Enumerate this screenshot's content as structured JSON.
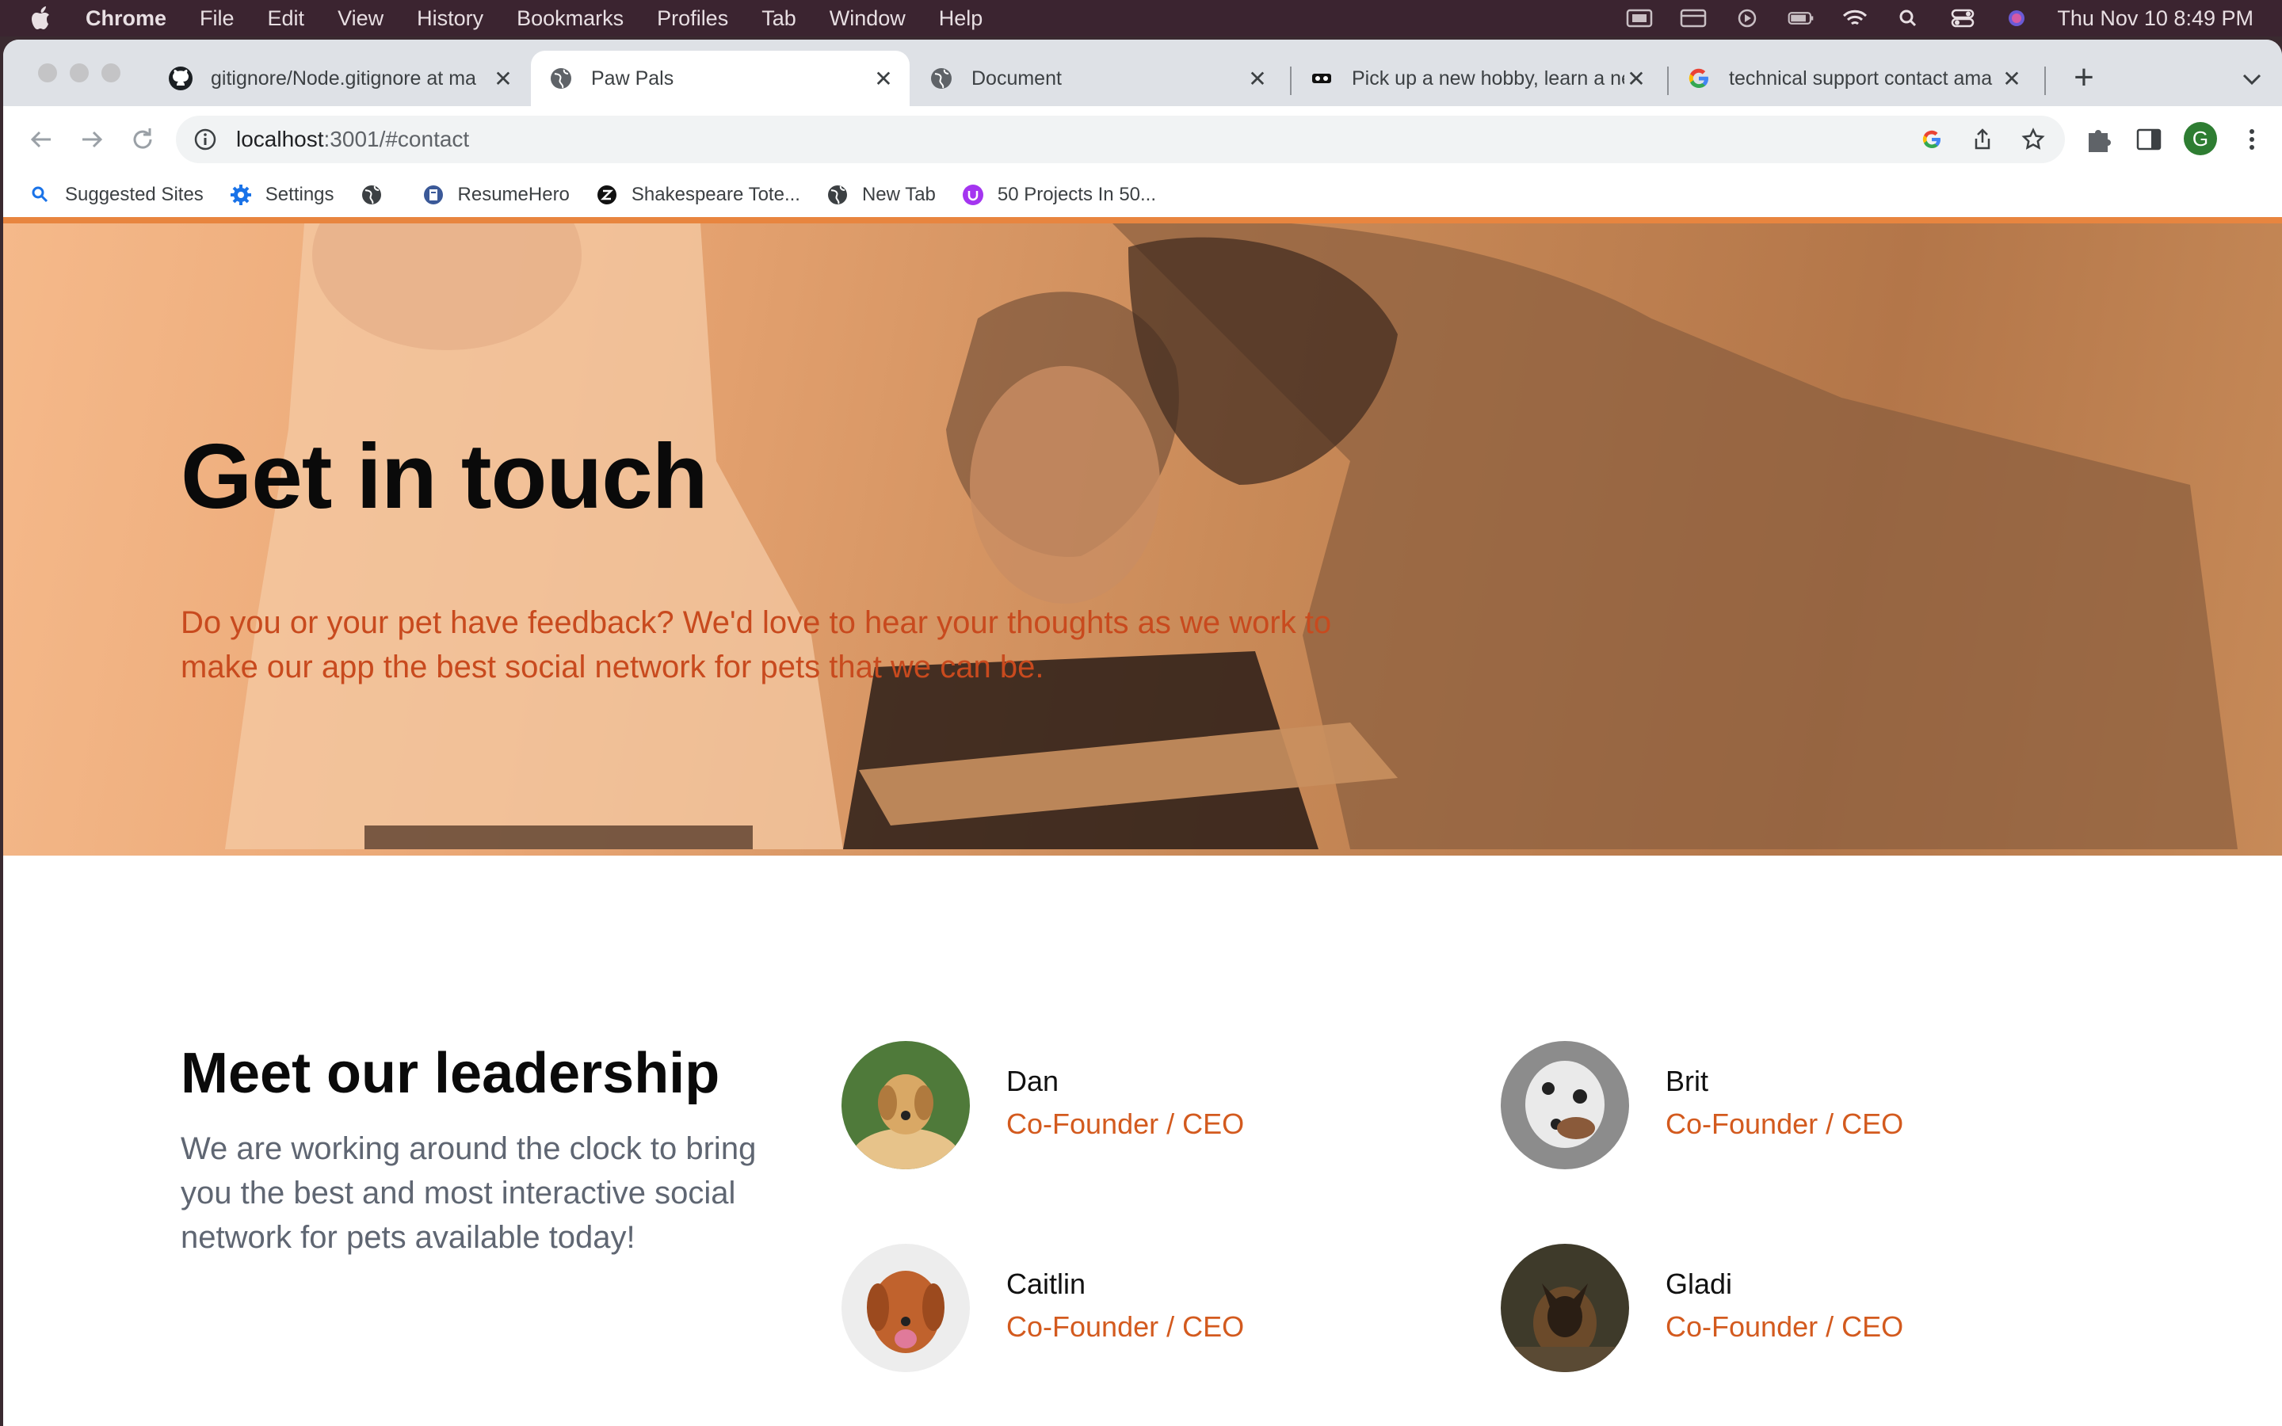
{
  "menubar": {
    "items": [
      "Chrome",
      "File",
      "Edit",
      "View",
      "History",
      "Bookmarks",
      "Profiles",
      "Tab",
      "Window",
      "Help"
    ],
    "clock": "Thu Nov 10  8:49 PM"
  },
  "tabs": [
    {
      "title": "gitignore/Node.gitignore at ma",
      "icon": "github-icon"
    },
    {
      "title": "Paw Pals",
      "icon": "globe-icon"
    },
    {
      "title": "Document",
      "icon": "globe-icon"
    },
    {
      "title": "Pick up a new hobby, learn a ne",
      "icon": "hobby-site-icon"
    },
    {
      "title": "technical support contact ama",
      "icon": "google-icon"
    }
  ],
  "toolbar": {
    "url_host": "localhost",
    "url_path": ":3001/#contact",
    "avatar_letter": "G"
  },
  "bookmarks": [
    {
      "label": "Suggested Sites",
      "icon": "search-icon"
    },
    {
      "label": "Settings",
      "icon": "gear-icon"
    },
    {
      "label": "",
      "icon": "globe-icon"
    },
    {
      "label": "ResumeHero",
      "icon": "resumehero-icon"
    },
    {
      "label": "Shakespeare Tote...",
      "icon": "shakespeare-icon"
    },
    {
      "label": "New Tab",
      "icon": "globe-icon"
    },
    {
      "label": "50 Projects In 50...",
      "icon": "udemy-icon"
    }
  ],
  "hero": {
    "title": "Get in touch",
    "text": "Do you or your pet have feedback? We'd love to hear your thoughts as we work to make our app the best social network for pets that we can be."
  },
  "leadership": {
    "title": "Meet our leadership",
    "text": "We are working around the clock to bring you the best and most interactive social network for pets available today!",
    "members": [
      {
        "name": "Dan",
        "role": "Co-Founder / CEO"
      },
      {
        "name": "Brit",
        "role": "Co-Founder / CEO"
      },
      {
        "name": "Caitlin",
        "role": "Co-Founder / CEO"
      },
      {
        "name": "Gladi",
        "role": "Co-Founder / CEO"
      }
    ]
  },
  "colors": {
    "accent": "#d35a1e",
    "hero_overlay": "#e9a674",
    "hero_border": "#e8853f"
  }
}
